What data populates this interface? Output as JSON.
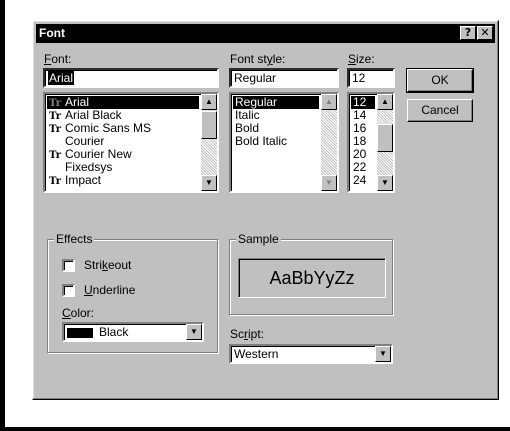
{
  "dialog": {
    "title": "Font",
    "help_button": "?",
    "close_button": "✕"
  },
  "font": {
    "label_key": "F",
    "label_rest": "ont:",
    "value": "Arial",
    "items": [
      "Arial",
      "Arial Black",
      "Comic Sans MS",
      "Courier",
      "Courier New",
      "Fixedsys",
      "Impact"
    ],
    "truetype": [
      true,
      true,
      true,
      false,
      true,
      false,
      true
    ],
    "selected_index": 0
  },
  "style": {
    "label_pre": "Font st",
    "label_key": "y",
    "label_rest": "le:",
    "value": "Regular",
    "items": [
      "Regular",
      "Italic",
      "Bold",
      "Bold Italic"
    ],
    "selected_index": 0
  },
  "size": {
    "label_key": "S",
    "label_rest": "ize:",
    "value": "12",
    "items": [
      "12",
      "14",
      "16",
      "18",
      "20",
      "22",
      "24"
    ],
    "selected_index": 0
  },
  "buttons": {
    "ok": "OK",
    "cancel": "Cancel"
  },
  "effects": {
    "title": "Effects",
    "strikeout_pre": "Stri",
    "strikeout_key": "k",
    "strikeout_rest": "eout",
    "strikeout_checked": false,
    "underline_key": "U",
    "underline_rest": "nderline",
    "underline_checked": false,
    "color_label_key": "C",
    "color_label_rest": "olor:",
    "color_value": "Black",
    "color_swatch": "#000000"
  },
  "sample": {
    "title": "Sample",
    "text": "AaBbYyZz"
  },
  "script": {
    "label_pre": "Sc",
    "label_key": "r",
    "label_rest": "ipt:",
    "value": "Western"
  },
  "colors": {
    "dialog_bg": "#c0c0c0",
    "title_bg": "#000000",
    "title_text": "#ffffff",
    "selection": "#000000"
  }
}
